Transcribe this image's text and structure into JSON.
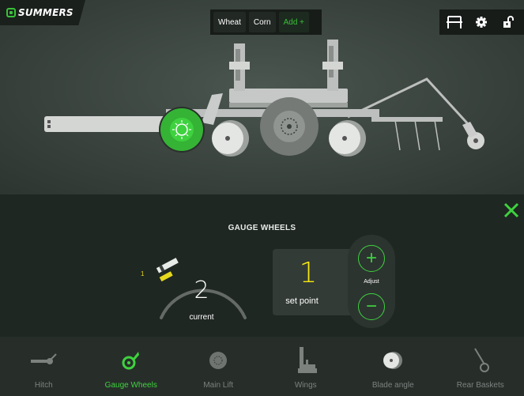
{
  "brand": {
    "name": "SUMMERS"
  },
  "crops": {
    "items": [
      "Wheat",
      "Corn"
    ],
    "add_label": "Add +"
  },
  "toolbar": {
    "icons": [
      "tractor-hitch-icon",
      "gear-icon",
      "unlock-icon"
    ]
  },
  "panel": {
    "title": "GAUGE WHEELS",
    "gauge": {
      "current_value": "2",
      "current_label": "current",
      "min_label": "1"
    },
    "set_point": {
      "value": "1",
      "label": "set point"
    },
    "adjust": {
      "label": "Adjust",
      "plus": "+",
      "minus": "−"
    }
  },
  "nav": {
    "items": [
      {
        "label": "Hitch",
        "icon": "hitch-icon",
        "active": false
      },
      {
        "label": "Gauge Wheels",
        "icon": "gauge-wheel-icon",
        "active": true
      },
      {
        "label": "Main Lift",
        "icon": "main-lift-icon",
        "active": false
      },
      {
        "label": "Wings",
        "icon": "wings-icon",
        "active": false
      },
      {
        "label": "Blade angle",
        "icon": "blade-angle-icon",
        "active": false
      },
      {
        "label": "Rear Baskets",
        "icon": "rear-baskets-icon",
        "active": false
      }
    ]
  },
  "colors": {
    "accent": "#3fd23f",
    "setpoint": "#f6e812",
    "panel_bg": "#1f2722"
  }
}
